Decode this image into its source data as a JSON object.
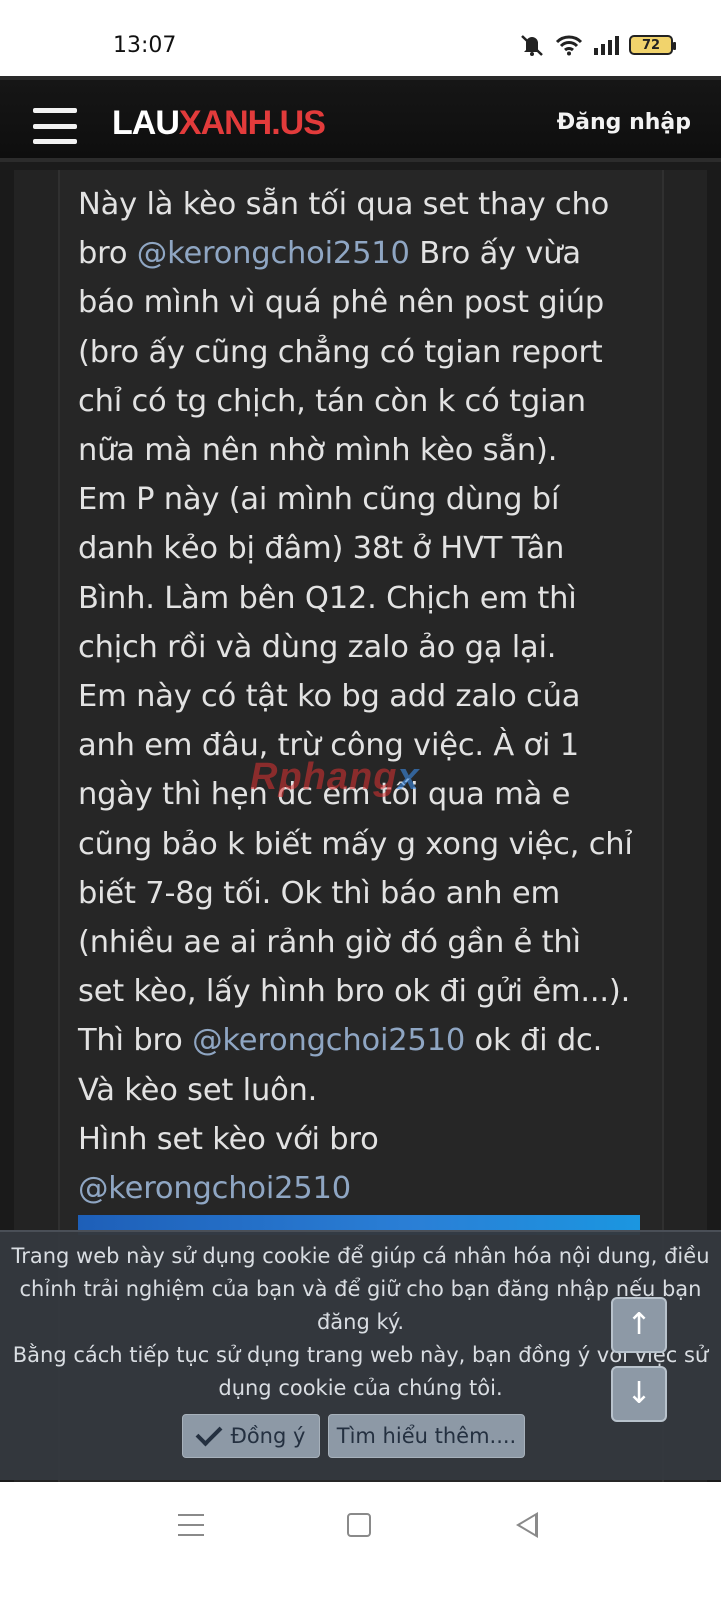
{
  "status_bar": {
    "time": "13:07",
    "battery": "72",
    "icons": [
      "mute-icon",
      "wifi-icon",
      "signal-icon",
      "battery-icon"
    ]
  },
  "header": {
    "logo_part1": "LAU",
    "logo_part2": "XANH.US",
    "login_label": "Đăng nhập"
  },
  "post": {
    "lines": [
      {
        "before": "Này là kèo sẵn tối qua set thay cho",
        "mention": "",
        "after": ""
      },
      {
        "before": "bro ",
        "mention": "@kerongchoi2510",
        "after": " Bro ấy vừa"
      },
      {
        "before": "báo mình vì quá phê nên post giúp",
        "mention": "",
        "after": ""
      },
      {
        "before": "(bro ấy cũng chẳng có tgian report",
        "mention": "",
        "after": ""
      },
      {
        "before": "chỉ có tg chịch, tán còn k có tgian",
        "mention": "",
        "after": ""
      },
      {
        "before": "nữa mà nên nhờ mình kèo sẵn).",
        "mention": "",
        "after": ""
      },
      {
        "before": "Em P này (ai mình cũng dùng bí",
        "mention": "",
        "after": ""
      },
      {
        "before": "danh kẻo bị đâm) 38t ở HVT Tân",
        "mention": "",
        "after": ""
      },
      {
        "before": "Bình. Làm bên Q12. Chịch em thì",
        "mention": "",
        "after": ""
      },
      {
        "before": "chịch rồi và dùng zalo ảo gạ lại.",
        "mention": "",
        "after": ""
      },
      {
        "before": "Em này có tật ko bg add zalo của",
        "mention": "",
        "after": ""
      },
      {
        "before": "anh em đâu, trừ công việc. À ơi 1",
        "mention": "",
        "after": ""
      },
      {
        "before": "ngày thì hẹn dc em tối qua mà e",
        "mention": "",
        "after": ""
      },
      {
        "before": "cũng bảo k biết mấy g xong việc, chỉ",
        "mention": "",
        "after": ""
      },
      {
        "before": "biết 7-8g tối. Ok thì báo anh em",
        "mention": "",
        "after": ""
      },
      {
        "before": "(nhiều ae ai rảnh giờ đó gần ẻ thì",
        "mention": "",
        "after": ""
      },
      {
        "before": "set kèo, lấy hình bro ok đi gửi ẻm...).",
        "mention": "",
        "after": ""
      },
      {
        "before": "Thì bro ",
        "mention": "@kerongchoi2510",
        "after": " ok đi dc."
      },
      {
        "before": "Và kèo set luôn.",
        "mention": "",
        "after": ""
      },
      {
        "before": "Hình set kèo với bro",
        "mention": "",
        "after": ""
      },
      {
        "before": "",
        "mention": "@kerongchoi2510",
        "after": ""
      }
    ]
  },
  "watermark": {
    "part1": "Rphang",
    "part2": "x"
  },
  "cookie_notice": {
    "lines": [
      "Trang web này sử dụng cookie để giúp cá nhân hóa nội dung, điều",
      "chỉnh trải nghiệm của bạn và để giữ cho bạn đăng nhập nếu bạn",
      "đăng ký.",
      "Bằng cách tiếp tục sử dụng trang web này, bạn đồng ý với việc sử",
      "dụng cookie của chúng tôi."
    ],
    "agree_label": "Đồng ý",
    "more_label": "Tìm hiểu thêm...."
  },
  "scroll": {
    "up_symbol": "↑",
    "down_symbol": "↓"
  }
}
